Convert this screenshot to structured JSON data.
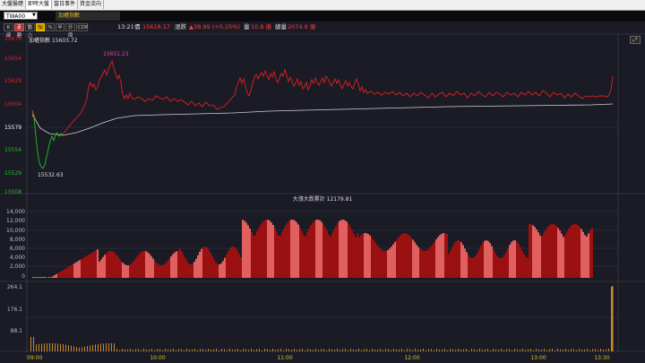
{
  "tabs": [
    {
      "label": "大盤醫礎",
      "active": false
    },
    {
      "label": "即時大盤",
      "active": true
    },
    {
      "label": "當日事件",
      "active": false
    },
    {
      "label": "資金流向",
      "active": false
    }
  ],
  "symbol": {
    "code": "TWA00",
    "name": "加權指數"
  },
  "buttons": [
    {
      "label": "K線",
      "selected": false
    },
    {
      "label": "走勢",
      "selected": true
    },
    {
      "label": "動力",
      "selected": false
    },
    {
      "label": "%",
      "selected": false,
      "highlight": true
    },
    {
      "label": "%",
      "selected": false
    },
    {
      "label": "半",
      "selected": false
    },
    {
      "label": "分價",
      "selected": false
    },
    {
      "label": "CDP",
      "selected": false
    }
  ],
  "quote": {
    "time": "13:21",
    "price_label": "價",
    "price": "15618.17",
    "change_label": "漲跌",
    "change": "▲38.99 (+0.25%)",
    "vol_label": "量",
    "vol": "10.8 億",
    "total_label": "總量",
    "total": "2074.8 億"
  },
  "price_panel": {
    "index_label": "加權指數 15603.72",
    "high_marker": "15651.23",
    "low_marker": "15532.63",
    "y_labels": [
      "15676",
      "15654",
      "15629",
      "15604",
      "15579",
      "15554",
      "15529",
      "15508"
    ],
    "y_label_colors": [
      "#e02020",
      "#e02020",
      "#e02020",
      "#e02020",
      "#ffffff",
      "#20c020",
      "#20c020",
      "#20c020"
    ]
  },
  "flow_panel": {
    "title": "大漲大跌累計 12179.81",
    "y_labels": [
      "14,000",
      "12,000",
      "10,000",
      "8,000",
      "6,000",
      "4,000",
      "2,000",
      "0"
    ]
  },
  "volume_panel": {
    "y_labels": [
      "264.1",
      "176.1",
      "88.1"
    ]
  },
  "time_axis": [
    "09:00",
    "10:00",
    "11:00",
    "12:00",
    "13:00",
    "13:30"
  ],
  "colors": {
    "up": "#e02020",
    "down": "#20c020",
    "avg": "#cfcfcf",
    "bar_dark": "#9b1010",
    "bar_light": "#e06060",
    "vol": "#c98a2a",
    "axis_time": "#e0c020"
  }
}
